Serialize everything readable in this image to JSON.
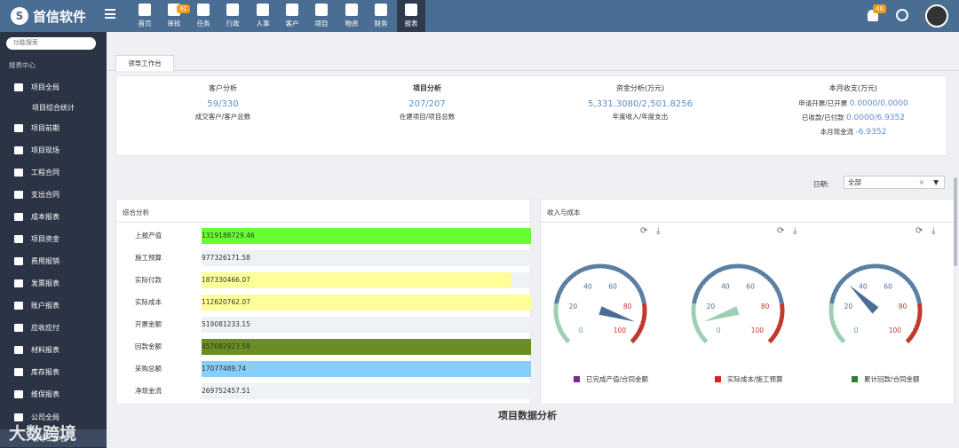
{
  "app": {
    "title": "首信软件"
  },
  "nav": [
    {
      "label": "首页",
      "badge": ""
    },
    {
      "label": "审批",
      "badge": "92"
    },
    {
      "label": "任务",
      "badge": ""
    },
    {
      "label": "行政",
      "badge": ""
    },
    {
      "label": "人事",
      "badge": ""
    },
    {
      "label": "客户",
      "badge": ""
    },
    {
      "label": "项目",
      "badge": ""
    },
    {
      "label": "物资",
      "badge": ""
    },
    {
      "label": "财务",
      "badge": ""
    },
    {
      "label": "报表",
      "badge": ""
    }
  ],
  "notifications": {
    "badge": "48"
  },
  "sidebar": {
    "search_placeholder": "功能搜索",
    "header": "报表中心",
    "items": [
      {
        "label": "项目全局"
      },
      {
        "label": "项目综合统计"
      },
      {
        "label": "项目前期"
      },
      {
        "label": "项目现场"
      },
      {
        "label": "工程合同"
      },
      {
        "label": "支出合同"
      },
      {
        "label": "成本报表"
      },
      {
        "label": "项目资金"
      },
      {
        "label": "费用报销"
      },
      {
        "label": "发票报表"
      },
      {
        "label": "账户报表"
      },
      {
        "label": "应收应付"
      },
      {
        "label": "材料报表"
      },
      {
        "label": "库存报表"
      },
      {
        "label": "维保报表"
      },
      {
        "label": "公司全局"
      },
      {
        "label": "领导工作台"
      }
    ]
  },
  "tabs": [
    {
      "label": "领导工作台"
    }
  ],
  "summary": {
    "customer": {
      "title": "客户分析",
      "value": "59/330",
      "sub": "成交客户/客户总数"
    },
    "project": {
      "title": "项目分析",
      "value": "207/207",
      "sub": "在建项目/项目总数"
    },
    "funds": {
      "title": "资金分析(万元)",
      "value": "5,331.3080/2,501.8256",
      "sub": "年度收入/年度支出"
    },
    "monthly": {
      "title": "本月收支(万元)",
      "r1_label": "申请开票/已开票",
      "r1_value": "0.0000/0.0000",
      "r2_label": "已收款/已付款",
      "r2_value": "0.0000/6.9352",
      "r3_label": "本月现金流",
      "r3_value": "-6.9352"
    }
  },
  "filter": {
    "label": "日期:",
    "value": "全部",
    "clear": "×",
    "caret": "▼"
  },
  "comprehensive": {
    "title": "综合分析",
    "rows": [
      {
        "label": "上报产值",
        "value": "1319188729.46",
        "fill": 1.0,
        "color": "#66ff33"
      },
      {
        "label": "施工预算",
        "value": "977326171.58",
        "fill": 0,
        "color": "#eef2f6"
      },
      {
        "label": "实际付款",
        "value": "187330466.07",
        "fill": 0.94,
        "color": "#ffff99"
      },
      {
        "label": "实际成本",
        "value": "112620762.07",
        "fill": 1.0,
        "color": "#ffff99"
      },
      {
        "label": "开票金额",
        "value": "519081233.15",
        "fill": 0,
        "color": "#eef2f6"
      },
      {
        "label": "回款金额",
        "value": "457082923.58",
        "fill": 1.0,
        "color": "#6b8e23"
      },
      {
        "label": "采购总额",
        "value": "17077489.74",
        "fill": 1.0,
        "color": "#87cefa"
      },
      {
        "label": "净现金流",
        "value": "269752457.51",
        "fill": 0,
        "color": "#eef2f6"
      }
    ]
  },
  "income_cost": {
    "title": "收入与成本",
    "tick_labels": [
      "0",
      "20",
      "40",
      "60",
      "80",
      "100"
    ],
    "gauges": [
      {
        "value": 90,
        "needle_color": "#4a6d94",
        "legend": "已完成产值/合同金额",
        "legend_color": "#7b2d8e"
      },
      {
        "value": 10,
        "needle_color": "#9fcfb3",
        "legend": "实际成本/施工预算",
        "legend_color": "#e02020"
      },
      {
        "value": 33,
        "needle_color": "#4a6d94",
        "legend": "累计回款/合同金额",
        "legend_color": "#2e7d32"
      }
    ]
  },
  "bottom_title": "项目数据分析",
  "watermark": "大数跨境"
}
